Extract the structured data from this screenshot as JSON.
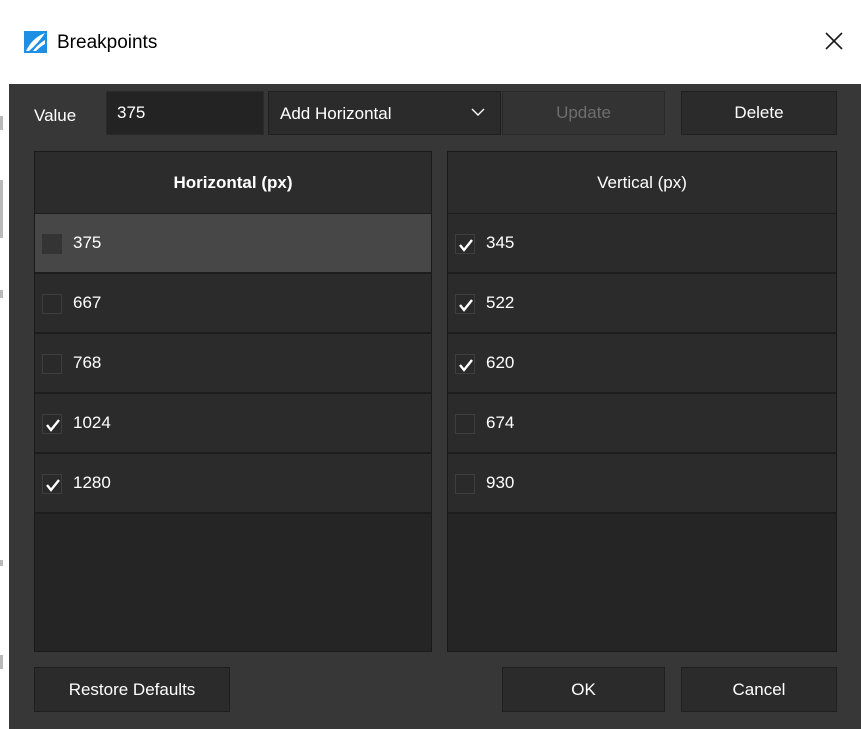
{
  "window": {
    "title": "Breakpoints"
  },
  "toolbar": {
    "value_label": "Value",
    "value_input": "375",
    "add_select_value": "Add Horizontal",
    "update_label": "Update",
    "delete_label": "Delete"
  },
  "horizontal": {
    "header": "Horizontal (px)",
    "rows": [
      {
        "value": "375",
        "checked": false,
        "selected": true
      },
      {
        "value": "667",
        "checked": false,
        "selected": false
      },
      {
        "value": "768",
        "checked": false,
        "selected": false
      },
      {
        "value": "1024",
        "checked": true,
        "selected": false
      },
      {
        "value": "1280",
        "checked": true,
        "selected": false
      }
    ]
  },
  "vertical": {
    "header": "Vertical (px)",
    "rows": [
      {
        "value": "345",
        "checked": true,
        "selected": false
      },
      {
        "value": "522",
        "checked": true,
        "selected": false
      },
      {
        "value": "620",
        "checked": true,
        "selected": false
      },
      {
        "value": "674",
        "checked": false,
        "selected": false
      },
      {
        "value": "930",
        "checked": false,
        "selected": false
      }
    ]
  },
  "footer": {
    "restore_label": "Restore Defaults",
    "ok_label": "OK",
    "cancel_label": "Cancel"
  },
  "colors": {
    "background": "#373737",
    "panel": "#2b2b2b",
    "selected_row": "#474747",
    "logo_blue": "#1e8fe3"
  }
}
